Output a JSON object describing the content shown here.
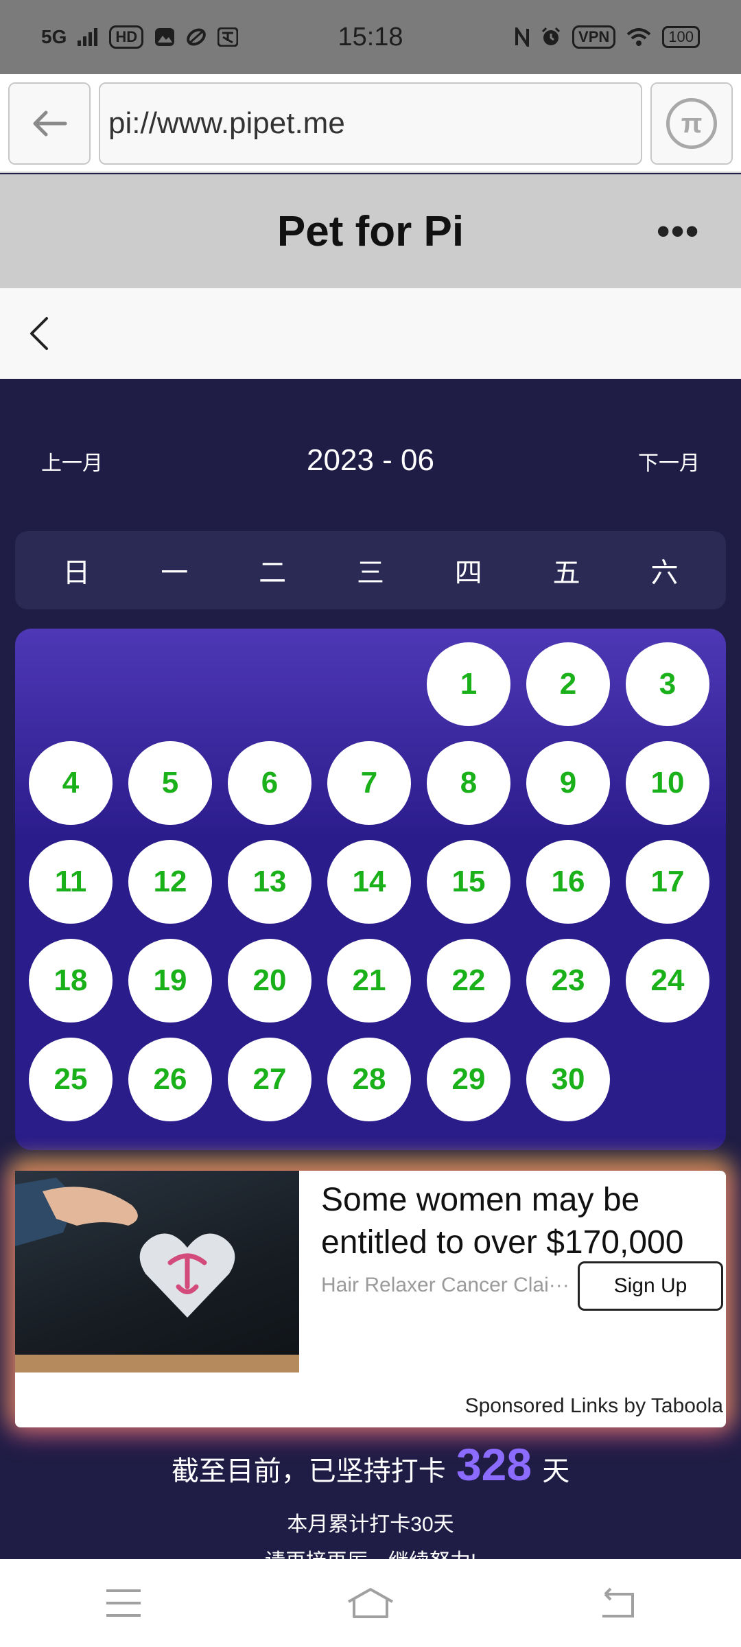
{
  "status_bar": {
    "time": "15:18",
    "network": "5G",
    "hd_badge": "HD",
    "vpn_badge": "VPN",
    "battery": "100"
  },
  "browser": {
    "url": "pi://www.pipet.me"
  },
  "app": {
    "title": "Pet for Pi",
    "more": "•••"
  },
  "calendar": {
    "prev_label": "上一月",
    "next_label": "下一月",
    "month": "2023 - 06",
    "weekdays": [
      "日",
      "一",
      "二",
      "三",
      "四",
      "五",
      "六"
    ],
    "days": [
      "1",
      "2",
      "3",
      "4",
      "5",
      "6",
      "7",
      "8",
      "9",
      "10",
      "11",
      "12",
      "13",
      "14",
      "15",
      "16",
      "17",
      "18",
      "19",
      "20",
      "21",
      "22",
      "23",
      "24",
      "25",
      "26",
      "27",
      "28",
      "29",
      "30"
    ],
    "day_color": "#19b019"
  },
  "ad": {
    "title": "Some women may be entitled to over $170,000",
    "source": "Hair Relaxer Cancer Clai···",
    "cta": "Sign Up",
    "footer": "Sponsored Links by Taboola"
  },
  "stats": {
    "streak_prefix": "截至目前，已坚持打卡",
    "streak_count": "328",
    "streak_suffix": "天",
    "month_total": "本月累计打卡30天",
    "encourage": "请再接再厉，继续努力!"
  },
  "colors": {
    "accent": "#8c6bff",
    "panel_top": "#4e38b5",
    "panel_bottom": "#2a1d8a",
    "background": "#1f1d45"
  }
}
